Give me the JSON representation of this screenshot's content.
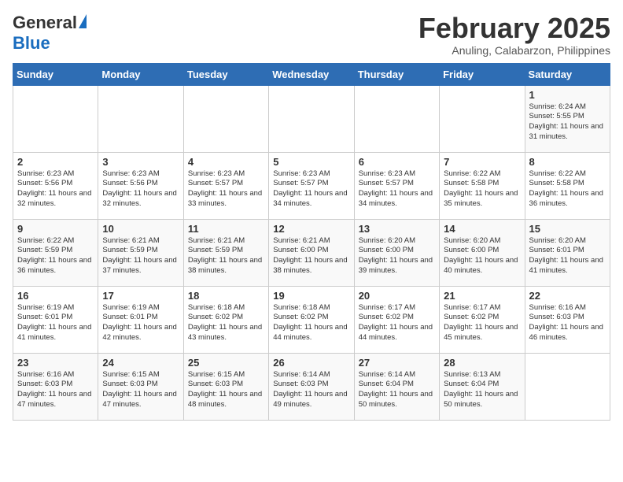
{
  "header": {
    "logo_general": "General",
    "logo_blue": "Blue",
    "month_title": "February 2025",
    "location": "Anuling, Calabarzon, Philippines"
  },
  "weekdays": [
    "Sunday",
    "Monday",
    "Tuesday",
    "Wednesday",
    "Thursday",
    "Friday",
    "Saturday"
  ],
  "weeks": [
    [
      {
        "day": "",
        "info": ""
      },
      {
        "day": "",
        "info": ""
      },
      {
        "day": "",
        "info": ""
      },
      {
        "day": "",
        "info": ""
      },
      {
        "day": "",
        "info": ""
      },
      {
        "day": "",
        "info": ""
      },
      {
        "day": "1",
        "info": "Sunrise: 6:24 AM\nSunset: 5:55 PM\nDaylight: 11 hours and 31 minutes."
      }
    ],
    [
      {
        "day": "2",
        "info": "Sunrise: 6:23 AM\nSunset: 5:56 PM\nDaylight: 11 hours and 32 minutes."
      },
      {
        "day": "3",
        "info": "Sunrise: 6:23 AM\nSunset: 5:56 PM\nDaylight: 11 hours and 32 minutes."
      },
      {
        "day": "4",
        "info": "Sunrise: 6:23 AM\nSunset: 5:57 PM\nDaylight: 11 hours and 33 minutes."
      },
      {
        "day": "5",
        "info": "Sunrise: 6:23 AM\nSunset: 5:57 PM\nDaylight: 11 hours and 34 minutes."
      },
      {
        "day": "6",
        "info": "Sunrise: 6:23 AM\nSunset: 5:57 PM\nDaylight: 11 hours and 34 minutes."
      },
      {
        "day": "7",
        "info": "Sunrise: 6:22 AM\nSunset: 5:58 PM\nDaylight: 11 hours and 35 minutes."
      },
      {
        "day": "8",
        "info": "Sunrise: 6:22 AM\nSunset: 5:58 PM\nDaylight: 11 hours and 36 minutes."
      }
    ],
    [
      {
        "day": "9",
        "info": "Sunrise: 6:22 AM\nSunset: 5:59 PM\nDaylight: 11 hours and 36 minutes."
      },
      {
        "day": "10",
        "info": "Sunrise: 6:21 AM\nSunset: 5:59 PM\nDaylight: 11 hours and 37 minutes."
      },
      {
        "day": "11",
        "info": "Sunrise: 6:21 AM\nSunset: 5:59 PM\nDaylight: 11 hours and 38 minutes."
      },
      {
        "day": "12",
        "info": "Sunrise: 6:21 AM\nSunset: 6:00 PM\nDaylight: 11 hours and 38 minutes."
      },
      {
        "day": "13",
        "info": "Sunrise: 6:20 AM\nSunset: 6:00 PM\nDaylight: 11 hours and 39 minutes."
      },
      {
        "day": "14",
        "info": "Sunrise: 6:20 AM\nSunset: 6:00 PM\nDaylight: 11 hours and 40 minutes."
      },
      {
        "day": "15",
        "info": "Sunrise: 6:20 AM\nSunset: 6:01 PM\nDaylight: 11 hours and 41 minutes."
      }
    ],
    [
      {
        "day": "16",
        "info": "Sunrise: 6:19 AM\nSunset: 6:01 PM\nDaylight: 11 hours and 41 minutes."
      },
      {
        "day": "17",
        "info": "Sunrise: 6:19 AM\nSunset: 6:01 PM\nDaylight: 11 hours and 42 minutes."
      },
      {
        "day": "18",
        "info": "Sunrise: 6:18 AM\nSunset: 6:02 PM\nDaylight: 11 hours and 43 minutes."
      },
      {
        "day": "19",
        "info": "Sunrise: 6:18 AM\nSunset: 6:02 PM\nDaylight: 11 hours and 44 minutes."
      },
      {
        "day": "20",
        "info": "Sunrise: 6:17 AM\nSunset: 6:02 PM\nDaylight: 11 hours and 44 minutes."
      },
      {
        "day": "21",
        "info": "Sunrise: 6:17 AM\nSunset: 6:02 PM\nDaylight: 11 hours and 45 minutes."
      },
      {
        "day": "22",
        "info": "Sunrise: 6:16 AM\nSunset: 6:03 PM\nDaylight: 11 hours and 46 minutes."
      }
    ],
    [
      {
        "day": "23",
        "info": "Sunrise: 6:16 AM\nSunset: 6:03 PM\nDaylight: 11 hours and 47 minutes."
      },
      {
        "day": "24",
        "info": "Sunrise: 6:15 AM\nSunset: 6:03 PM\nDaylight: 11 hours and 47 minutes."
      },
      {
        "day": "25",
        "info": "Sunrise: 6:15 AM\nSunset: 6:03 PM\nDaylight: 11 hours and 48 minutes."
      },
      {
        "day": "26",
        "info": "Sunrise: 6:14 AM\nSunset: 6:03 PM\nDaylight: 11 hours and 49 minutes."
      },
      {
        "day": "27",
        "info": "Sunrise: 6:14 AM\nSunset: 6:04 PM\nDaylight: 11 hours and 50 minutes."
      },
      {
        "day": "28",
        "info": "Sunrise: 6:13 AM\nSunset: 6:04 PM\nDaylight: 11 hours and 50 minutes."
      },
      {
        "day": "",
        "info": ""
      }
    ]
  ]
}
